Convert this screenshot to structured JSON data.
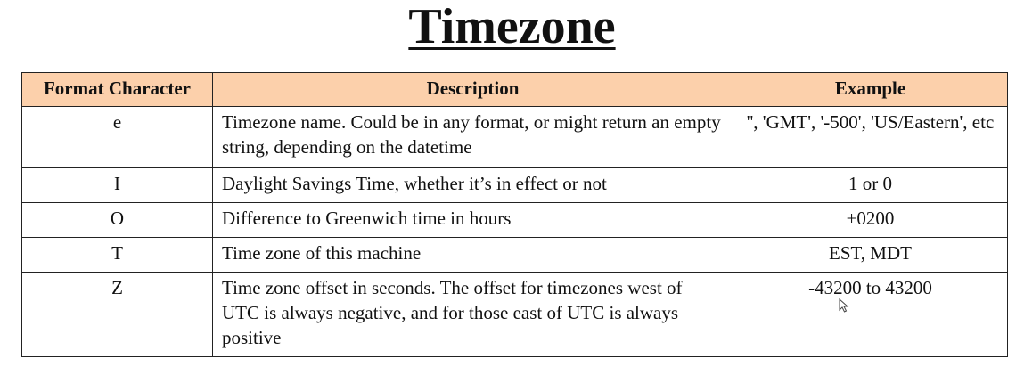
{
  "title": "Timezone",
  "table": {
    "headers": [
      "Format Character",
      "Description",
      "Example"
    ],
    "rows": [
      {
        "char": "e",
        "desc": "Timezone name. Could be in any format, or might return an empty string, depending on the datetime",
        "example": "'', 'GMT', '-500', 'US/Eastern', etc"
      },
      {
        "char": "I",
        "desc": "Daylight Savings Time, whether it’s in effect or not",
        "example": "1 or 0"
      },
      {
        "char": "O",
        "desc": "Difference to Greenwich time in hours",
        "example": "+0200"
      },
      {
        "char": "T",
        "desc": "Time zone of this machine",
        "example": "EST, MDT"
      },
      {
        "char": "Z",
        "desc": "Time zone offset in seconds. The offset for timezones west of UTC is always negative, and for those east of UTC is always positive",
        "example": "-43200 to 43200"
      }
    ]
  },
  "colors": {
    "header_bg": "#fcd0ab",
    "border": "#222222"
  },
  "icons": {
    "cursor": "mouse-pointer-icon"
  }
}
